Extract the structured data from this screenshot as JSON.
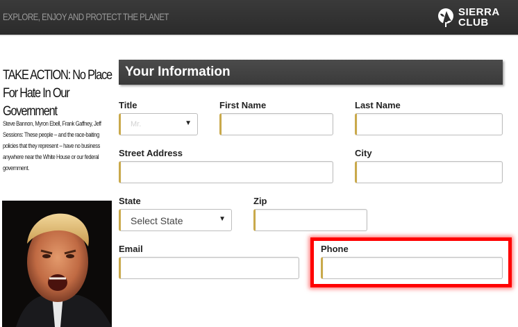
{
  "header": {
    "tagline": "EXPLORE, ENJOY AND PROTECT THE PLANET",
    "logo_line1": "SIERRA",
    "logo_line2": "CLUB"
  },
  "sidebar": {
    "title": "TAKE ACTION: No Place For Hate In Our Government",
    "body": "Steve Bannon, Myron Ebell, Frank Gaffney, Jeff Sessions: These people -- and the race-baiting policies that they represent -- have no business anywhere near the White House or our federal government."
  },
  "form": {
    "section_title": "Your Information",
    "title_label": "Title",
    "title_value": "Mr.",
    "first_name_label": "First Name",
    "last_name_label": "Last Name",
    "street_label": "Street Address",
    "city_label": "City",
    "state_label": "State",
    "state_value": "Select State",
    "zip_label": "Zip",
    "email_label": "Email",
    "phone_label": "Phone"
  },
  "colors": {
    "accent": "#c9a94b",
    "header_bg": "#2e2e2e",
    "highlight": "#ff0000"
  }
}
